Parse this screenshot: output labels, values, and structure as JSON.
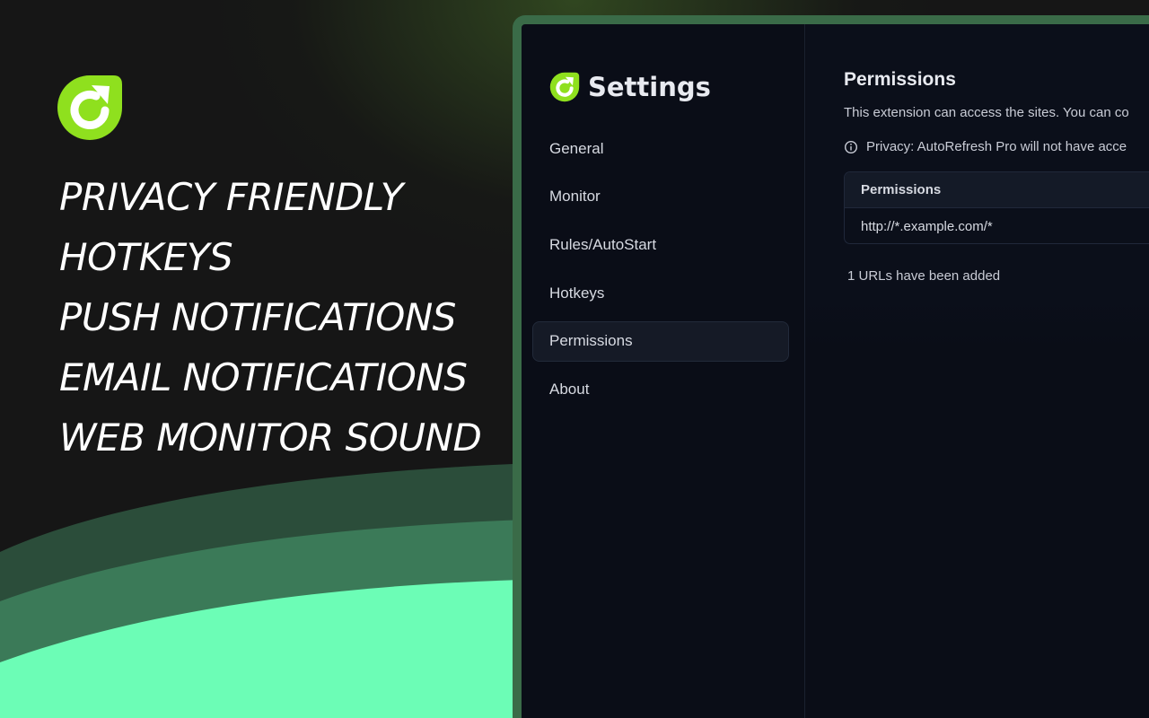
{
  "promo": {
    "features": [
      "PRIVACY FRIENDLY",
      "HOTKEYS",
      "PUSH NOTIFICATIONS",
      "EMAIL NOTIFICATIONS",
      "WEB MONITOR SOUND"
    ],
    "logo_icon": "refresh-logo-icon"
  },
  "sidebar": {
    "title": "Settings",
    "items": [
      {
        "label": "General"
      },
      {
        "label": "Monitor"
      },
      {
        "label": "Rules/AutoStart"
      },
      {
        "label": "Hotkeys"
      },
      {
        "label": "Permissions",
        "active": true
      },
      {
        "label": "About"
      }
    ]
  },
  "permissions": {
    "title": "Permissions",
    "description": "This extension can access the sites. You can co",
    "privacy_note": "Privacy: AutoRefresh Pro will not have acce",
    "table_header": "Permissions",
    "rows": [
      "http://*.example.com/*"
    ],
    "count_text": "1 URLs have been added"
  },
  "colors": {
    "brand_green": "#8fe01e",
    "wave_light": "#6cfdb6",
    "wave_mid": "#3b7a58",
    "window_border": "#3a6b48",
    "panel_bg": "#0a0d17"
  }
}
